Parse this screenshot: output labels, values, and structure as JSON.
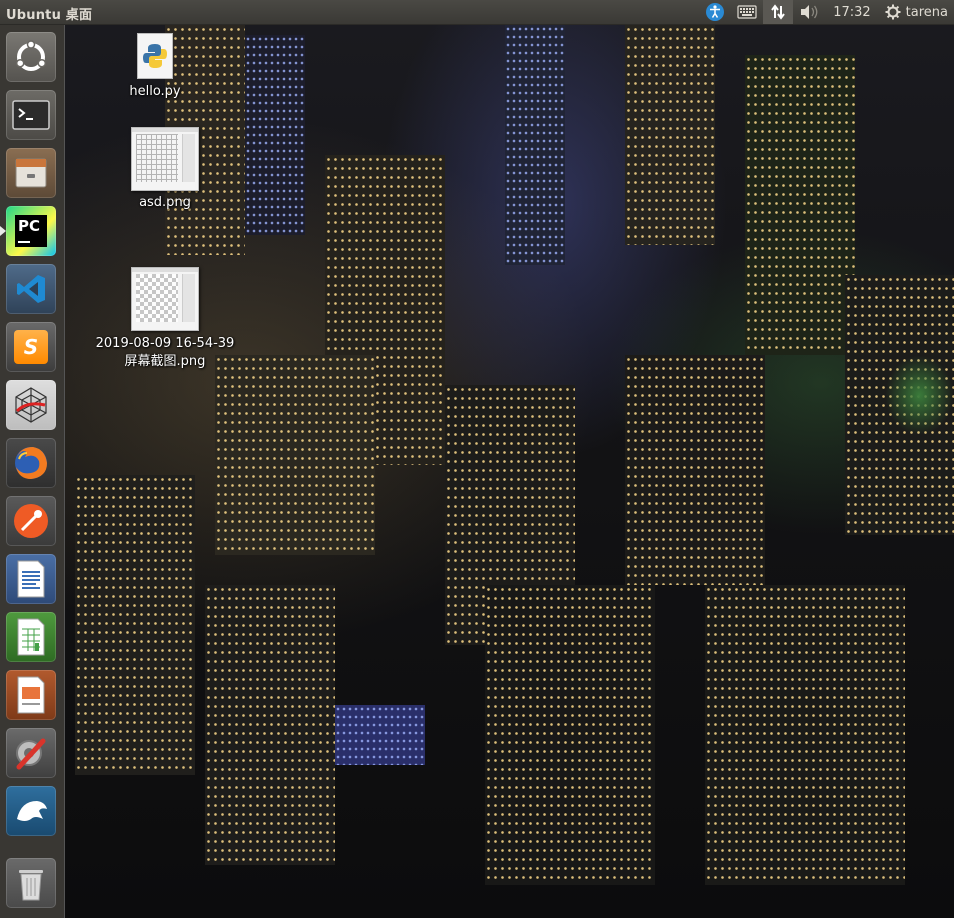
{
  "topbar": {
    "title": "Ubuntu 桌面",
    "clock": "17:32",
    "user": "tarena",
    "tray_icons": [
      "accessibility-icon",
      "keyboard-icon",
      "network-icon",
      "volume-icon",
      "settings-gear-icon"
    ]
  },
  "launcher": {
    "items": [
      {
        "name": "ubuntu-dash",
        "icon": "ubuntu-logo-icon"
      },
      {
        "name": "terminal",
        "icon": "terminal-icon"
      },
      {
        "name": "files",
        "icon": "file-cabinet-icon"
      },
      {
        "name": "pycharm",
        "icon": "pycharm-icon",
        "label": "PC",
        "running": true
      },
      {
        "name": "vscode",
        "icon": "vscode-icon"
      },
      {
        "name": "sublime-text",
        "icon": "sublime-icon",
        "label": "S"
      },
      {
        "name": "spider-app",
        "icon": "spider-web-icon"
      },
      {
        "name": "firefox",
        "icon": "firefox-icon"
      },
      {
        "name": "postman",
        "icon": "postman-icon"
      },
      {
        "name": "libreoffice-writer",
        "icon": "writer-icon"
      },
      {
        "name": "libreoffice-calc",
        "icon": "calc-icon"
      },
      {
        "name": "libreoffice-impress",
        "icon": "impress-icon"
      },
      {
        "name": "system-settings",
        "icon": "wrench-settings-icon"
      },
      {
        "name": "mysql-workbench",
        "icon": "dolphin-icon"
      },
      {
        "name": "trash",
        "icon": "trash-icon"
      }
    ]
  },
  "desktop": {
    "icons": [
      {
        "label": "hello.py",
        "icon": "python-file-icon"
      },
      {
        "label": "asd.png",
        "icon": "image-thumbnail-icon"
      },
      {
        "label_line1": "2019-08-09 16-54-39",
        "label_line2": "屏幕截图.png",
        "icon": "image-thumbnail-icon"
      }
    ]
  }
}
